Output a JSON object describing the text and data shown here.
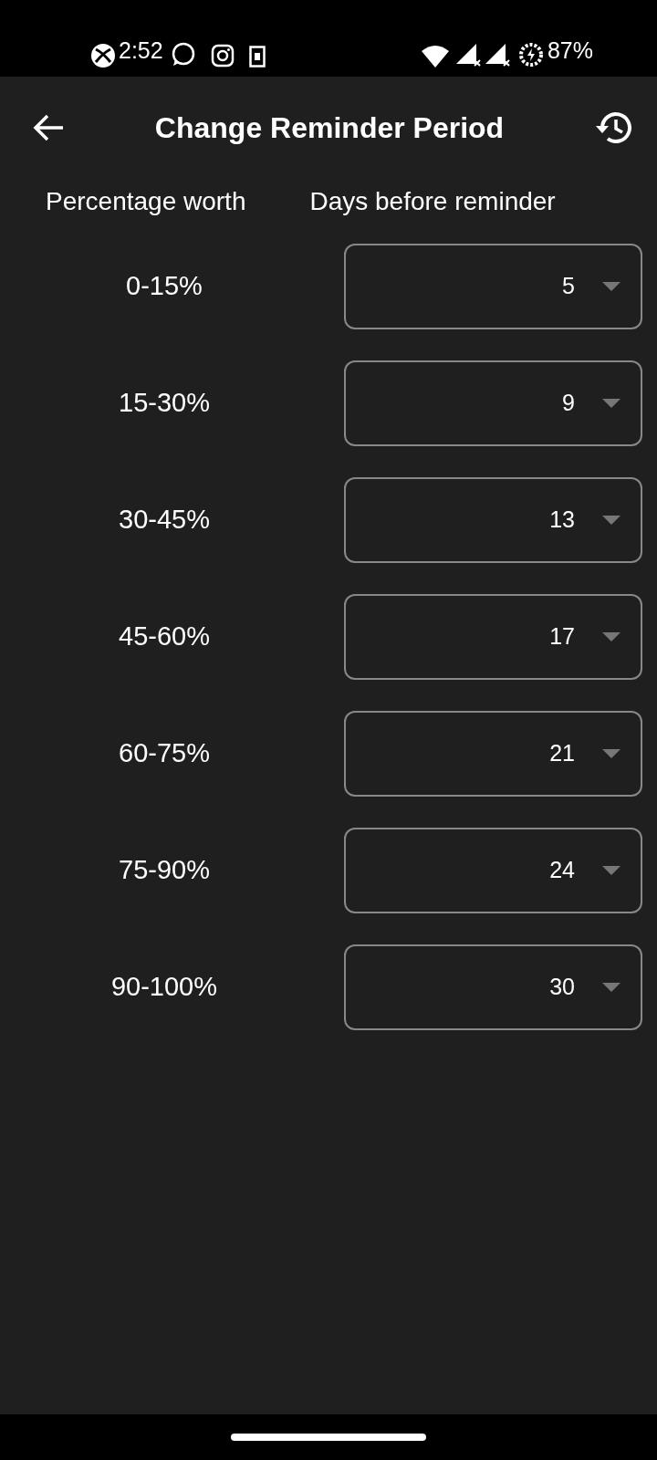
{
  "status_bar": {
    "time": "2:52",
    "battery": "87%"
  },
  "app_bar": {
    "title": "Change Reminder Period"
  },
  "columns": [
    "Percentage worth",
    "Days before reminder"
  ],
  "rows": [
    {
      "range": "0-15%",
      "days": "5"
    },
    {
      "range": "15-30%",
      "days": "9"
    },
    {
      "range": "30-45%",
      "days": "13"
    },
    {
      "range": "45-60%",
      "days": "17"
    },
    {
      "range": "60-75%",
      "days": "21"
    },
    {
      "range": "75-90%",
      "days": "24"
    },
    {
      "range": "90-100%",
      "days": "30"
    }
  ]
}
